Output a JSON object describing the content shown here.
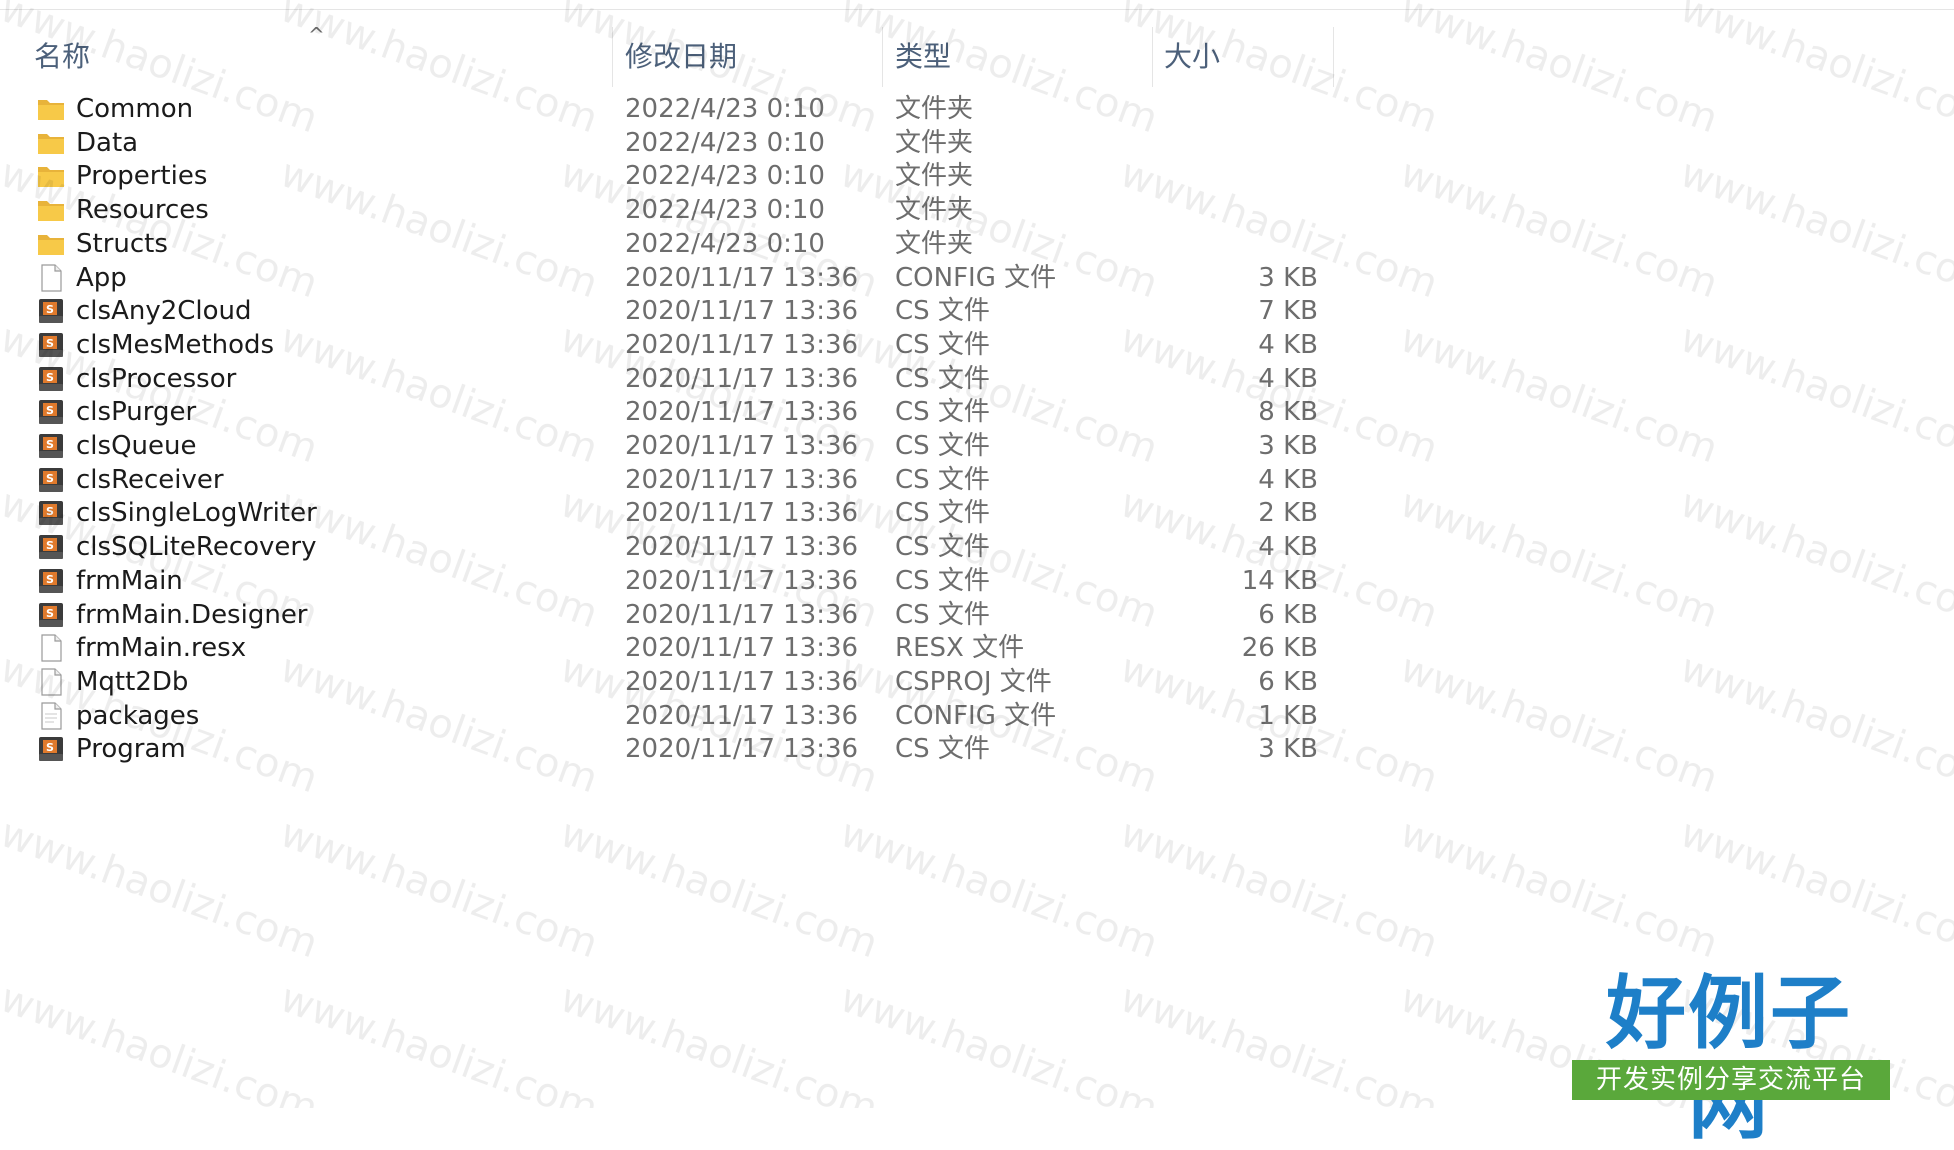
{
  "columns": {
    "name": "名称",
    "date": "修改日期",
    "type": "类型",
    "size": "大小"
  },
  "sort_indicator": "^",
  "files": [
    {
      "name": "Common",
      "date": "2022/4/23 0:10",
      "type": "文件夹",
      "size": "",
      "icon": "folder-icon"
    },
    {
      "name": "Data",
      "date": "2022/4/23 0:10",
      "type": "文件夹",
      "size": "",
      "icon": "folder-icon"
    },
    {
      "name": "Properties",
      "date": "2022/4/23 0:10",
      "type": "文件夹",
      "size": "",
      "icon": "folder-icon"
    },
    {
      "name": "Resources",
      "date": "2022/4/23 0:10",
      "type": "文件夹",
      "size": "",
      "icon": "folder-icon"
    },
    {
      "name": "Structs",
      "date": "2022/4/23 0:10",
      "type": "文件夹",
      "size": "",
      "icon": "folder-icon"
    },
    {
      "name": "App",
      "date": "2020/11/17 13:36",
      "type": "CONFIG 文件",
      "size": "3 KB",
      "icon": "blank-file-icon"
    },
    {
      "name": "clsAny2Cloud",
      "date": "2020/11/17 13:36",
      "type": "CS 文件",
      "size": "7 KB",
      "icon": "cs-file-icon"
    },
    {
      "name": "clsMesMethods",
      "date": "2020/11/17 13:36",
      "type": "CS 文件",
      "size": "4 KB",
      "icon": "cs-file-icon"
    },
    {
      "name": "clsProcessor",
      "date": "2020/11/17 13:36",
      "type": "CS 文件",
      "size": "4 KB",
      "icon": "cs-file-icon"
    },
    {
      "name": "clsPurger",
      "date": "2020/11/17 13:36",
      "type": "CS 文件",
      "size": "8 KB",
      "icon": "cs-file-icon"
    },
    {
      "name": "clsQueue",
      "date": "2020/11/17 13:36",
      "type": "CS 文件",
      "size": "3 KB",
      "icon": "cs-file-icon"
    },
    {
      "name": "clsReceiver",
      "date": "2020/11/17 13:36",
      "type": "CS 文件",
      "size": "4 KB",
      "icon": "cs-file-icon"
    },
    {
      "name": "clsSingleLogWriter",
      "date": "2020/11/17 13:36",
      "type": "CS 文件",
      "size": "2 KB",
      "icon": "cs-file-icon"
    },
    {
      "name": "clsSQLiteRecovery",
      "date": "2020/11/17 13:36",
      "type": "CS 文件",
      "size": "4 KB",
      "icon": "cs-file-icon"
    },
    {
      "name": "frmMain",
      "date": "2020/11/17 13:36",
      "type": "CS 文件",
      "size": "14 KB",
      "icon": "cs-file-icon"
    },
    {
      "name": "frmMain.Designer",
      "date": "2020/11/17 13:36",
      "type": "CS 文件",
      "size": "6 KB",
      "icon": "cs-file-icon"
    },
    {
      "name": "frmMain.resx",
      "date": "2020/11/17 13:36",
      "type": "RESX 文件",
      "size": "26 KB",
      "icon": "blank-file-icon"
    },
    {
      "name": "Mqtt2Db",
      "date": "2020/11/17 13:36",
      "type": "CSPROJ 文件",
      "size": "6 KB",
      "icon": "blank-file-icon"
    },
    {
      "name": "packages",
      "date": "2020/11/17 13:36",
      "type": "CONFIG 文件",
      "size": "1 KB",
      "icon": "config-file-icon"
    },
    {
      "name": "Program",
      "date": "2020/11/17 13:36",
      "type": "CS 文件",
      "size": "3 KB",
      "icon": "cs-file-icon"
    }
  ],
  "watermark": "www.haolizi.com",
  "logo": {
    "title": "好例子网",
    "subtitle": "开发实例分享交流平台"
  },
  "colors": {
    "header_text": "#4c607a",
    "name_text": "#1b1b1b",
    "detail_text": "#6d6d6d",
    "folder": "#f7c948",
    "logo_blue": "#1e7fc8",
    "logo_green": "#5aa83b"
  }
}
